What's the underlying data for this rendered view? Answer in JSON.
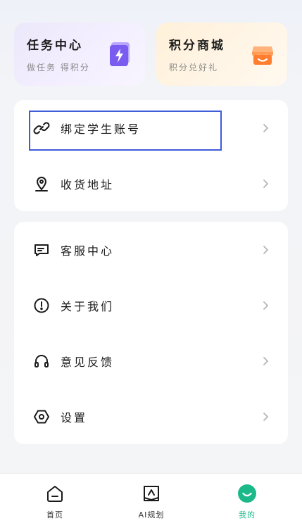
{
  "promos": {
    "tasks": {
      "title": "任务中心",
      "subtitle": "做任务 得积分",
      "icon": "lightning-badge-icon",
      "color": "#8b6df0"
    },
    "mall": {
      "title": "积分商城",
      "subtitle": "积分兑好礼",
      "icon": "shop-icon",
      "color": "#ff8a3d"
    }
  },
  "menu_top": [
    {
      "label": "绑定学生账号",
      "icon": "link-icon"
    },
    {
      "label": "收货地址",
      "icon": "location-pin-icon"
    }
  ],
  "menu_bottom": [
    {
      "label": "客服中心",
      "icon": "message-icon"
    },
    {
      "label": "关于我们",
      "icon": "info-icon"
    },
    {
      "label": "意见反馈",
      "icon": "headphones-icon"
    },
    {
      "label": "设置",
      "icon": "settings-hexagon-icon"
    }
  ],
  "bottom_nav": [
    {
      "label": "首页",
      "icon": "home-icon",
      "active": false
    },
    {
      "label": "AI规划",
      "icon": "ai-book-icon",
      "active": false
    },
    {
      "label": "我的",
      "icon": "profile-smile-icon",
      "active": true
    }
  ],
  "colors": {
    "accent": "#1bb98a",
    "highlight": "#3e5bd8"
  }
}
